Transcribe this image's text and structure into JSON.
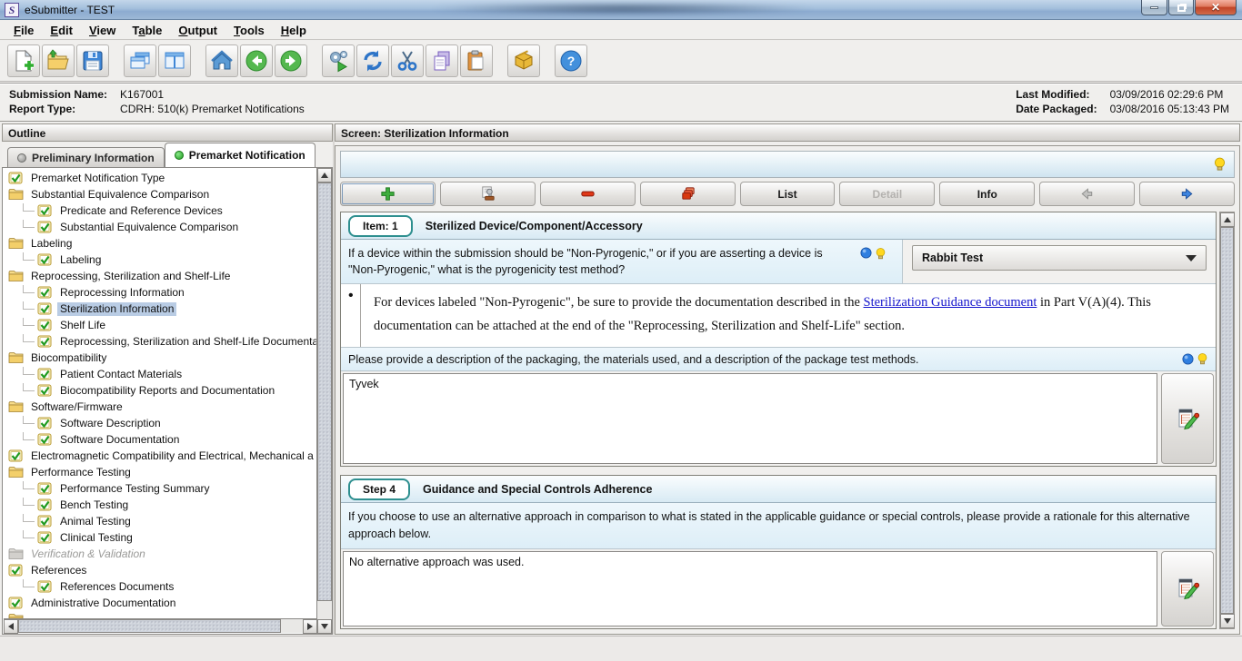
{
  "window": {
    "title": "eSubmitter - TEST",
    "icon_letter": "S"
  },
  "menu": {
    "items": [
      {
        "label": "File",
        "mnemonic": "F"
      },
      {
        "label": "Edit",
        "mnemonic": "E"
      },
      {
        "label": "View",
        "mnemonic": "V"
      },
      {
        "label": "Table",
        "mnemonic": "a"
      },
      {
        "label": "Output",
        "mnemonic": "O"
      },
      {
        "label": "Tools",
        "mnemonic": "T"
      },
      {
        "label": "Help",
        "mnemonic": "H"
      }
    ]
  },
  "toolbar": {
    "icons": [
      "new-document",
      "open",
      "save",
      "cascade-windows",
      "split-view",
      "home",
      "back",
      "forward",
      "run-report",
      "refresh",
      "cut",
      "copy",
      "paste",
      "package",
      "help"
    ]
  },
  "info_bar": {
    "submission_name_label": "Submission Name:",
    "submission_name": "K167001",
    "report_type_label": "Report Type:",
    "report_type": "CDRH: 510(k) Premarket Notifications",
    "last_modified_label": "Last Modified:",
    "last_modified": "03/09/2016 02:29:6 PM",
    "date_packaged_label": "Date Packaged:",
    "date_packaged": "03/08/2016 05:13:43 PM"
  },
  "outline": {
    "header": "Outline",
    "tabs": [
      {
        "label": "Preliminary Information",
        "active": false,
        "dot_color": "#a8a8a6"
      },
      {
        "label": "Premarket Notification",
        "active": true,
        "dot_color": "#2eb52e"
      }
    ],
    "tree": [
      {
        "label": "Premarket Notification Type",
        "icon": "check",
        "level": 0
      },
      {
        "label": "Substantial Equivalence Comparison",
        "icon": "folder",
        "level": 0
      },
      {
        "label": "Predicate and Reference Devices",
        "icon": "check",
        "level": 1
      },
      {
        "label": "Substantial Equivalence Comparison",
        "icon": "check",
        "level": 1
      },
      {
        "label": "Labeling",
        "icon": "folder",
        "level": 0
      },
      {
        "label": "Labeling",
        "icon": "check",
        "level": 1
      },
      {
        "label": "Reprocessing, Sterilization and Shelf-Life",
        "icon": "folder",
        "level": 0
      },
      {
        "label": "Reprocessing Information",
        "icon": "check",
        "level": 1
      },
      {
        "label": "Sterilization Information",
        "icon": "check",
        "level": 1,
        "selected": true
      },
      {
        "label": "Shelf Life",
        "icon": "check",
        "level": 1
      },
      {
        "label": "Reprocessing, Sterilization and Shelf-Life Documenta",
        "icon": "check",
        "level": 1
      },
      {
        "label": "Biocompatibility",
        "icon": "folder",
        "level": 0
      },
      {
        "label": "Patient Contact Materials",
        "icon": "check",
        "level": 1
      },
      {
        "label": "Biocompatibility Reports and Documentation",
        "icon": "check",
        "level": 1
      },
      {
        "label": "Software/Firmware",
        "icon": "folder",
        "level": 0
      },
      {
        "label": "Software Description",
        "icon": "check",
        "level": 1
      },
      {
        "label": "Software Documentation",
        "icon": "check",
        "level": 1
      },
      {
        "label": "Electromagnetic Compatibility and Electrical, Mechanical a",
        "icon": "check",
        "level": 0
      },
      {
        "label": "Performance Testing",
        "icon": "folder",
        "level": 0
      },
      {
        "label": "Performance Testing Summary",
        "icon": "check",
        "level": 1
      },
      {
        "label": "Bench Testing",
        "icon": "check",
        "level": 1
      },
      {
        "label": "Animal Testing",
        "icon": "check",
        "level": 1
      },
      {
        "label": "Clinical Testing",
        "icon": "check",
        "level": 1
      },
      {
        "label": "Verification & Validation",
        "icon": "folder-disabled",
        "level": 0,
        "disabled": true
      },
      {
        "label": "References",
        "icon": "check",
        "level": 0
      },
      {
        "label": "References Documents",
        "icon": "check",
        "level": 1
      },
      {
        "label": "Administrative Documentation",
        "icon": "check",
        "level": 0
      },
      {
        "label": "",
        "icon": "folder",
        "level": 0
      }
    ]
  },
  "screen": {
    "header": "Screen: Sterilization Information",
    "toolbar": {
      "list_label": "List",
      "detail_label": "Detail",
      "info_label": "Info"
    },
    "item_header": {
      "badge": "Item: 1",
      "title": "Sterilized Device/Component/Accessory"
    },
    "question1": {
      "text": "If a device within the submission should be \"Non-Pyrogenic,\" or if you are asserting a device is \"Non-Pyrogenic,\" what is the pyrogenicity test method?",
      "dropdown_value": "Rabbit Test"
    },
    "note": {
      "pre": "For devices labeled \"Non-Pyrogenic\", be sure to provide the documentation described in the ",
      "link": "Sterilization Guidance document",
      "post": " in Part V(A)(4). This documentation can be attached at the end of the \"Reprocessing, Sterilization and Shelf-Life\" section.",
      "bullet": "•"
    },
    "question2": {
      "text": "Please provide a description of the packaging, the materials used, and a description of the package test methods.",
      "answer": "Tyvek"
    },
    "step": {
      "badge": "Step 4",
      "title": "Guidance and Special Controls Adherence",
      "text": "If you choose to use an alternative approach in comparison to what is stated in the applicable guidance or special controls, please provide a rationale for this alternative approach below.",
      "answer": "No alternative approach was used."
    }
  },
  "colors": {
    "selection": "#b9cce4",
    "badge_border": "#2e8f8f",
    "link": "#1414cc",
    "question_bg": "#ddeef7",
    "titlebar": "#9db8d6"
  }
}
